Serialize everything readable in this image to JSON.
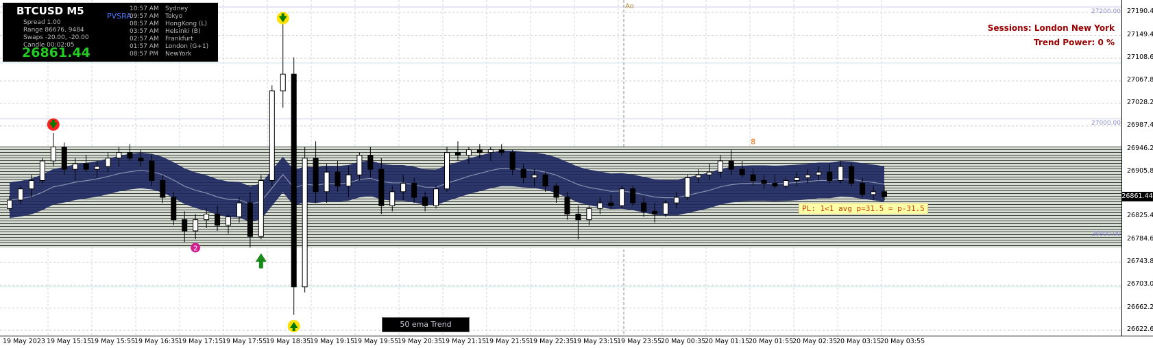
{
  "info": {
    "symbol": "BTCUSD  M5",
    "spread": "Spread   1.00",
    "range": "Range   86676, 9484",
    "swaps": "Swaps   -20.00, -20.00",
    "candle": "Candle   00:02:05",
    "price": "26861.44",
    "pvsra": "PVSRA",
    "sessions": [
      {
        "time": "10:57 AM",
        "city": "Sydney"
      },
      {
        "time": "09:57 AM",
        "city": "Tokyo"
      },
      {
        "time": "08:57 AM",
        "city": "HongKong  (L)"
      },
      {
        "time": "03:57 AM",
        "city": "Helsinki  (B)"
      },
      {
        "time": "02:57 AM",
        "city": "Frankfurt"
      },
      {
        "time": "01:57 AM",
        "city": "London  (G+1)"
      },
      {
        "time": "08:57 PM",
        "city": "NewYork"
      }
    ]
  },
  "overlay": {
    "sessions": "Sessions:  London  New York",
    "trend_power": "Trend Power: 0 %",
    "pl_label": "PL: 1<1 avg p=31.5 = p-31.5",
    "ema_label": "50 ema Trend",
    "ao": "Ao",
    "ref_27200": "27200.00",
    "ref_27000": "27000.00",
    "ref_26800": "26800.00",
    "marker_2": "2",
    "marker_8": "8"
  },
  "price_axis": [
    "27190.40",
    "27149.40",
    "27108.60",
    "27067.80",
    "27028.20",
    "26987.40",
    "26946.20",
    "26905.80",
    "26861.44",
    "26825.40",
    "26784.60",
    "26743.80",
    "26703.00",
    "26662.20",
    "26622.60"
  ],
  "current_price": "26861.44",
  "time_axis": [
    "19 May 2023",
    "19 May 15:15",
    "19 May 15:55",
    "19 May 16:35",
    "19 May 17:15",
    "19 May 17:55",
    "19 May 18:35",
    "19 May 19:15",
    "19 May 19:55",
    "19 May 20:35",
    "19 May 21:15",
    "19 May 21:55",
    "19 May 22:35",
    "19 May 23:15",
    "19 May 23:55",
    "20 May 00:35",
    "20 May 01:15",
    "20 May 01:55",
    "20 May 02:35",
    "20 May 03:15",
    "20 May 03:55"
  ],
  "colors": {
    "band": "#1e2860",
    "grid": "#b8c2c2",
    "candle_up": "#ffffff",
    "candle_down": "#000000",
    "sessions_text": "#9a0000",
    "price_green": "#22cc22"
  },
  "chart_data": {
    "type": "candlestick",
    "symbol": "BTCUSD",
    "timeframe": "M5",
    "ylim": [
      26622.6,
      27190.4
    ],
    "ohlc": [
      {
        "o": 26840,
        "h": 26862,
        "l": 26835,
        "c": 26855
      },
      {
        "o": 26855,
        "h": 26880,
        "l": 26848,
        "c": 26875
      },
      {
        "o": 26875,
        "h": 26900,
        "l": 26860,
        "c": 26890
      },
      {
        "o": 26890,
        "h": 26930,
        "l": 26885,
        "c": 26925
      },
      {
        "o": 26925,
        "h": 26975,
        "l": 26915,
        "c": 26950
      },
      {
        "o": 26950,
        "h": 26958,
        "l": 26900,
        "c": 26910
      },
      {
        "o": 26910,
        "h": 26930,
        "l": 26890,
        "c": 26920
      },
      {
        "o": 26920,
        "h": 26935,
        "l": 26905,
        "c": 26910
      },
      {
        "o": 26910,
        "h": 26925,
        "l": 26895,
        "c": 26915
      },
      {
        "o": 26915,
        "h": 26940,
        "l": 26905,
        "c": 26930
      },
      {
        "o": 26930,
        "h": 26950,
        "l": 26915,
        "c": 26940
      },
      {
        "o": 26940,
        "h": 26955,
        "l": 26925,
        "c": 26930
      },
      {
        "o": 26930,
        "h": 26945,
        "l": 26915,
        "c": 26925
      },
      {
        "o": 26925,
        "h": 26935,
        "l": 26880,
        "c": 26890
      },
      {
        "o": 26890,
        "h": 26900,
        "l": 26850,
        "c": 26860
      },
      {
        "o": 26860,
        "h": 26870,
        "l": 26810,
        "c": 26820
      },
      {
        "o": 26820,
        "h": 26835,
        "l": 26780,
        "c": 26800
      },
      {
        "o": 26800,
        "h": 26830,
        "l": 26785,
        "c": 26820
      },
      {
        "o": 26820,
        "h": 26840,
        "l": 26805,
        "c": 26830
      },
      {
        "o": 26830,
        "h": 26845,
        "l": 26800,
        "c": 26810
      },
      {
        "o": 26810,
        "h": 26830,
        "l": 26795,
        "c": 26825
      },
      {
        "o": 26825,
        "h": 26860,
        "l": 26815,
        "c": 26850
      },
      {
        "o": 26850,
        "h": 26870,
        "l": 26770,
        "c": 26790
      },
      {
        "o": 26790,
        "h": 26900,
        "l": 26785,
        "c": 26890
      },
      {
        "o": 26890,
        "h": 27060,
        "l": 26880,
        "c": 27050
      },
      {
        "o": 27050,
        "h": 27180,
        "l": 27020,
        "c": 27080
      },
      {
        "o": 27080,
        "h": 27110,
        "l": 26650,
        "c": 26700
      },
      {
        "o": 26700,
        "h": 26950,
        "l": 26690,
        "c": 26930
      },
      {
        "o": 26930,
        "h": 26960,
        "l": 26850,
        "c": 26870
      },
      {
        "o": 26870,
        "h": 26920,
        "l": 26850,
        "c": 26905
      },
      {
        "o": 26905,
        "h": 26925,
        "l": 26870,
        "c": 26880
      },
      {
        "o": 26880,
        "h": 26915,
        "l": 26860,
        "c": 26900
      },
      {
        "o": 26900,
        "h": 26940,
        "l": 26890,
        "c": 26935
      },
      {
        "o": 26935,
        "h": 26950,
        "l": 26895,
        "c": 26910
      },
      {
        "o": 26910,
        "h": 26930,
        "l": 26830,
        "c": 26845
      },
      {
        "o": 26845,
        "h": 26880,
        "l": 26835,
        "c": 26870
      },
      {
        "o": 26870,
        "h": 26900,
        "l": 26855,
        "c": 26885
      },
      {
        "o": 26885,
        "h": 26895,
        "l": 26850,
        "c": 26860
      },
      {
        "o": 26860,
        "h": 26870,
        "l": 26835,
        "c": 26845
      },
      {
        "o": 26845,
        "h": 26880,
        "l": 26840,
        "c": 26875
      },
      {
        "o": 26875,
        "h": 26950,
        "l": 26870,
        "c": 26940
      },
      {
        "o": 26940,
        "h": 26960,
        "l": 26925,
        "c": 26935
      },
      {
        "o": 26935,
        "h": 26950,
        "l": 26920,
        "c": 26945
      },
      {
        "o": 26945,
        "h": 26955,
        "l": 26930,
        "c": 26940
      },
      {
        "o": 26940,
        "h": 26950,
        "l": 26925,
        "c": 26945
      },
      {
        "o": 26945,
        "h": 26955,
        "l": 26935,
        "c": 26940
      },
      {
        "o": 26940,
        "h": 26945,
        "l": 26900,
        "c": 26910
      },
      {
        "o": 26910,
        "h": 26920,
        "l": 26885,
        "c": 26895
      },
      {
        "o": 26895,
        "h": 26910,
        "l": 26880,
        "c": 26900
      },
      {
        "o": 26900,
        "h": 26905,
        "l": 26870,
        "c": 26880
      },
      {
        "o": 26880,
        "h": 26885,
        "l": 26850,
        "c": 26860
      },
      {
        "o": 26860,
        "h": 26870,
        "l": 26820,
        "c": 26830
      },
      {
        "o": 26830,
        "h": 26845,
        "l": 26785,
        "c": 26820
      },
      {
        "o": 26820,
        "h": 26845,
        "l": 26810,
        "c": 26840
      },
      {
        "o": 26840,
        "h": 26860,
        "l": 26830,
        "c": 26850
      },
      {
        "o": 26850,
        "h": 26865,
        "l": 26840,
        "c": 26845
      },
      {
        "o": 26845,
        "h": 26880,
        "l": 26840,
        "c": 26875
      },
      {
        "o": 26875,
        "h": 26880,
        "l": 26845,
        "c": 26850
      },
      {
        "o": 26850,
        "h": 26860,
        "l": 26825,
        "c": 26835
      },
      {
        "o": 26835,
        "h": 26850,
        "l": 26815,
        "c": 26830
      },
      {
        "o": 26830,
        "h": 26855,
        "l": 26825,
        "c": 26850
      },
      {
        "o": 26850,
        "h": 26870,
        "l": 26840,
        "c": 26860
      },
      {
        "o": 26860,
        "h": 26900,
        "l": 26855,
        "c": 26895
      },
      {
        "o": 26895,
        "h": 26910,
        "l": 26885,
        "c": 26900
      },
      {
        "o": 26900,
        "h": 26920,
        "l": 26890,
        "c": 26905
      },
      {
        "o": 26905,
        "h": 26935,
        "l": 26895,
        "c": 26925
      },
      {
        "o": 26925,
        "h": 26945,
        "l": 26900,
        "c": 26910
      },
      {
        "o": 26910,
        "h": 26925,
        "l": 26895,
        "c": 26900
      },
      {
        "o": 26900,
        "h": 26910,
        "l": 26880,
        "c": 26890
      },
      {
        "o": 26890,
        "h": 26900,
        "l": 26875,
        "c": 26885
      },
      {
        "o": 26885,
        "h": 26900,
        "l": 26875,
        "c": 26880
      },
      {
        "o": 26880,
        "h": 26895,
        "l": 26875,
        "c": 26890
      },
      {
        "o": 26890,
        "h": 26905,
        "l": 26880,
        "c": 26895
      },
      {
        "o": 26895,
        "h": 26910,
        "l": 26885,
        "c": 26900
      },
      {
        "o": 26900,
        "h": 26915,
        "l": 26890,
        "c": 26905
      },
      {
        "o": 26905,
        "h": 26920,
        "l": 26885,
        "c": 26890
      },
      {
        "o": 26890,
        "h": 26925,
        "l": 26885,
        "c": 26915
      },
      {
        "o": 26915,
        "h": 26920,
        "l": 26880,
        "c": 26885
      },
      {
        "o": 26885,
        "h": 26895,
        "l": 26860,
        "c": 26865
      },
      {
        "o": 26865,
        "h": 26880,
        "l": 26855,
        "c": 26870
      },
      {
        "o": 26870,
        "h": 26880,
        "l": 26855,
        "c": 26861
      }
    ]
  }
}
